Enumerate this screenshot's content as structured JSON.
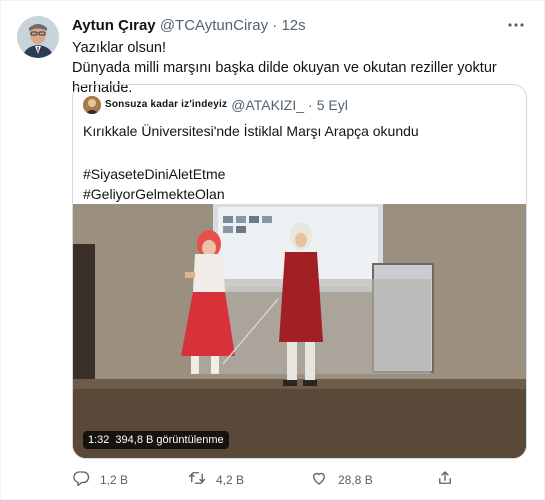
{
  "tweet": {
    "author_name": "Aytun Çıray",
    "author_handle": "@TCAytunCiray",
    "separator": "·",
    "time": "12s",
    "text_line1": "Yazıklar olsun!",
    "text_line2": "Dünyada milli marşını başka dilde okuyan ve okutan reziller yoktur herhalde."
  },
  "quoted": {
    "author_name": "Sonsuza kadar iz'indeyiz",
    "author_handle": "@ATAKIZI_",
    "separator": "·",
    "date": "5 Eyl",
    "text": "Kırıkkale Üniversitesi'nde İstiklal Marşı Arapça okundu",
    "hashtag1": "#SiyaseteDiniAletEtme",
    "hashtag2": "#GeliyorGelmekteOlan",
    "video": {
      "duration": "1:32",
      "views": "394,8 B görüntülenme"
    }
  },
  "actions": {
    "reply_count": "1,2 B",
    "retweet_count": "4,2 B",
    "like_count": "28,8 B"
  },
  "icons": [
    "more-icon",
    "reply-icon",
    "retweet-icon",
    "like-icon",
    "share-icon"
  ],
  "colors": {
    "text": "#0f1419",
    "muted": "#536471",
    "border": "#cfd9de"
  }
}
